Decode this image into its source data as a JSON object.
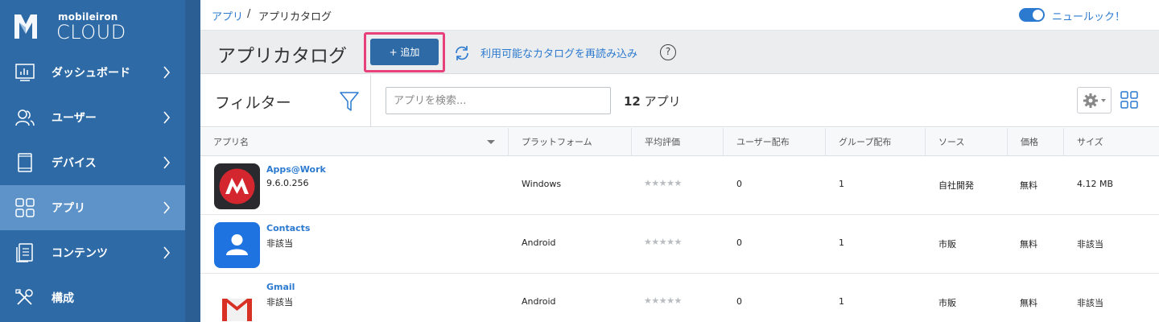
{
  "logo": {
    "small": "mobileiron",
    "big": "CLOUD"
  },
  "sidebar": {
    "items": [
      {
        "label": "ダッシュボード",
        "icon": "dashboard-icon",
        "active": false
      },
      {
        "label": "ユーザー",
        "icon": "users-icon",
        "active": false
      },
      {
        "label": "デバイス",
        "icon": "devices-icon",
        "active": false
      },
      {
        "label": "アプリ",
        "icon": "apps-icon",
        "active": true
      },
      {
        "label": "コンテンツ",
        "icon": "content-icon",
        "active": false
      },
      {
        "label": "構成",
        "icon": "configuration-icon",
        "active": false
      }
    ]
  },
  "breadcrumb": {
    "link": "アプリ",
    "separator": "/",
    "current": "アプリカタログ"
  },
  "top_right": {
    "new_look_label": "ニュールック！",
    "toggle_on": true
  },
  "header": {
    "title": "アプリカタログ",
    "add_button": "+ 追加",
    "reload_label": "利用可能なカタログを再読み込み",
    "help": "?"
  },
  "filter": {
    "title": "フィルター",
    "search_placeholder": "アプリを検索...",
    "count_number": "12",
    "count_unit": "アプリ"
  },
  "table": {
    "columns": [
      "アプリ名",
      "プラットフォーム",
      "平均評価",
      "ユーザー配布",
      "グループ配布",
      "ソース",
      "価格",
      "サイズ"
    ],
    "rows": [
      {
        "name": "Apps@Work",
        "version": "9.6.0.256",
        "platform": "Windows",
        "rating": "★★★★★",
        "user_dist": "0",
        "group_dist": "1",
        "source": "自社開発",
        "price": "無料",
        "size": "4.12 MB",
        "icon": "mobileiron-app-icon"
      },
      {
        "name": "Contacts",
        "version": "非該当",
        "platform": "Android",
        "rating": "★★★★★",
        "user_dist": "0",
        "group_dist": "1",
        "source": "市販",
        "price": "無料",
        "size": "非該当",
        "icon": "contacts-app-icon"
      },
      {
        "name": "Gmail",
        "version": "非該当",
        "platform": "Android",
        "rating": "★★★★★",
        "user_dist": "0",
        "group_dist": "1",
        "source": "市販",
        "price": "無料",
        "size": "非該当",
        "icon": "gmail-app-icon"
      }
    ]
  },
  "colors": {
    "sidebar": "#2d6aa6",
    "active_nav": "#5d93c9",
    "link": "#2c7ad0",
    "highlight": "#e8417a"
  }
}
